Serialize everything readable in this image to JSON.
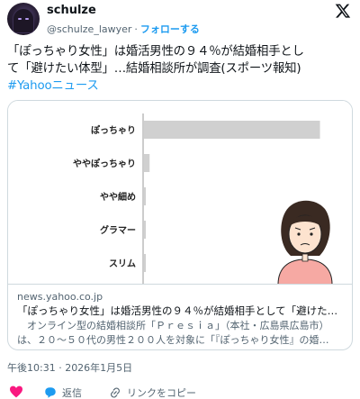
{
  "user": {
    "name": "schulze",
    "handle": "@schulze_lawyer",
    "separator": "·",
    "follow_label": "フォローする"
  },
  "tweet": {
    "line1": "「ぽっちゃり女性」は婚活男性の９４％が結婚相手とし",
    "line2": "て「避けたい体型」…結婚相談所が調査(スポーツ報知)",
    "hashtag": "#Yahooニュース"
  },
  "card": {
    "domain": "news.yahoo.co.jp",
    "title": "「ぽっちゃり女性」は婚活男性の９４％が結婚相手として「避けたい…",
    "desc_line1": "　オンライン型の結婚相談所「Ｐｒｅｓｉａ」（本社・広島県広島市）",
    "desc_line2": "は、２０～５０代の男性２００人を対象に「『ぽっちゃり女性』の婚…"
  },
  "timestamp": "午後10:31 · 2026年1月5日",
  "actions": {
    "reply_label": "返信",
    "copy_link_label": "リンクをコピー"
  },
  "icons": [
    "x-logo-icon",
    "heart-icon",
    "reply-icon",
    "link-icon"
  ],
  "colors": {
    "accent": "#1d9bf0",
    "like": "#f91880",
    "bar": "#d0d0d0",
    "muted": "#536471"
  },
  "chart_data": {
    "type": "bar",
    "orientation": "horizontal",
    "categories": [
      "ぽっちゃり",
      "ややぽっちゃり",
      "やや細め",
      "グラマー",
      "スリム"
    ],
    "values": [
      94,
      3,
      1,
      1,
      1
    ],
    "title": "",
    "xlabel": "",
    "ylabel": "",
    "xlim": [
      0,
      100
    ],
    "grid": false,
    "legend": "none"
  }
}
